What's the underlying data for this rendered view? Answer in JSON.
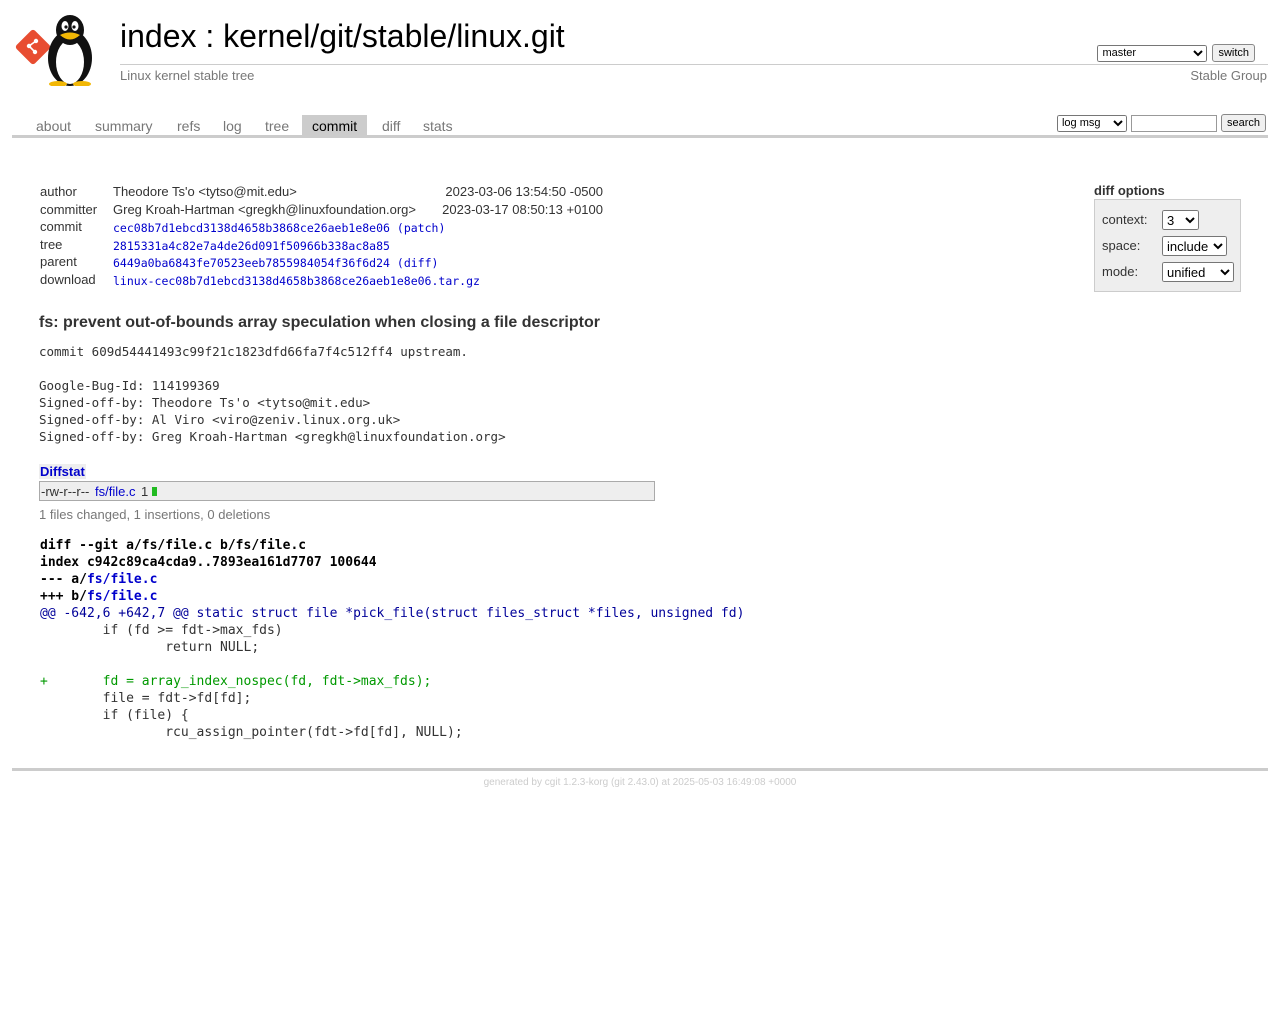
{
  "header": {
    "index_link": "index",
    "separator": ":",
    "repo_path": "kernel/git/stable/linux.git",
    "description": "Linux kernel stable tree",
    "owner": "Stable Group",
    "branch_selected": "master",
    "switch_button": "switch"
  },
  "tabs": [
    {
      "label": "about"
    },
    {
      "label": "summary"
    },
    {
      "label": "refs"
    },
    {
      "label": "log"
    },
    {
      "label": "tree"
    },
    {
      "label": "commit",
      "active": true
    },
    {
      "label": "diff"
    },
    {
      "label": "stats"
    }
  ],
  "search": {
    "mode_selected": "log msg",
    "query": "",
    "button": "search"
  },
  "commit_info": {
    "author": {
      "label": "author",
      "value": "Theodore Ts'o <tytso@mit.edu>",
      "date": "2023-03-06 13:54:50 -0500"
    },
    "committer": {
      "label": "committer",
      "value": "Greg Kroah-Hartman <gregkh@linuxfoundation.org>",
      "date": "2023-03-17 08:50:13 +0100"
    },
    "commit": {
      "label": "commit",
      "value": "cec08b7d1ebcd3138d4658b3868ce26aeb1e8e06",
      "extra_open": "(",
      "extra": "patch",
      "extra_close": ")"
    },
    "tree": {
      "label": "tree",
      "value": "2815331a4c82e7a4de26d091f50966b338ac8a85"
    },
    "parent": {
      "label": "parent",
      "value": "6449a0ba6843fe70523eeb7855984054f36f6d24",
      "extra_open": "(",
      "extra": "diff",
      "extra_close": ")"
    },
    "download": {
      "label": "download",
      "value": "linux-cec08b7d1ebcd3138d4658b3868ce26aeb1e8e06.tar.gz"
    }
  },
  "diff_options": {
    "title": "diff options",
    "context": {
      "label": "context:",
      "value": "3"
    },
    "space": {
      "label": "space:",
      "value": "include"
    },
    "mode": {
      "label": "mode:",
      "value": "unified"
    }
  },
  "subject": "fs: prevent out-of-bounds array speculation when closing a file descriptor",
  "message": "commit 609d54441493c99f21c1823dfd66fa7f4c512ff4 upstream.\n\nGoogle-Bug-Id: 114199369\nSigned-off-by: Theodore Ts'o <tytso@mit.edu>\nSigned-off-by: Al Viro <viro@zeniv.linux.org.uk>\nSigned-off-by: Greg Kroah-Hartman <gregkh@linuxfoundation.org>",
  "diffstat": {
    "title": "Diffstat",
    "mode": "-rw-r--r--",
    "file": "fs/file.c",
    "count": "1",
    "summary": "1 files changed, 1 insertions, 0 deletions"
  },
  "diff": {
    "line1": "diff --git a/fs/file.c b/fs/file.c",
    "line2": "index c942c89ca4cda9..7893ea161d7707 100644",
    "minus_prefix": "--- a/",
    "minus_file": "fs/file.c",
    "plus_prefix": "+++ b/",
    "plus_file": "fs/file.c",
    "hunk": "@@ -642,6 +642,7 @@ static struct file *pick_file(struct files_struct *files, unsigned fd)",
    "lines": [
      {
        "type": "ctx",
        "text": " \tif (fd >= fdt->max_fds)"
      },
      {
        "type": "ctx",
        "text": " \t\treturn NULL;"
      },
      {
        "type": "ctx",
        "text": " "
      },
      {
        "type": "add",
        "text": "+\tfd = array_index_nospec(fd, fdt->max_fds);"
      },
      {
        "type": "ctx",
        "text": " \tfile = fdt->fd[fd];"
      },
      {
        "type": "ctx",
        "text": " \tif (file) {"
      },
      {
        "type": "ctx",
        "text": " \t\trcu_assign_pointer(fdt->fd[fd], NULL);"
      }
    ]
  },
  "footer": {
    "generated_by": "generated by",
    "cgit": "cgit 1.2.3-korg",
    "git": "(git 2.43.0)",
    "at": "at 2025-05-03 16:49:08 +0000"
  },
  "colors": {
    "accent_link": "#0000cc",
    "tab_active_bg": "#cccccc",
    "diff_add": "#009900",
    "hunk": "#000099",
    "logo_red": "#e84d31"
  }
}
